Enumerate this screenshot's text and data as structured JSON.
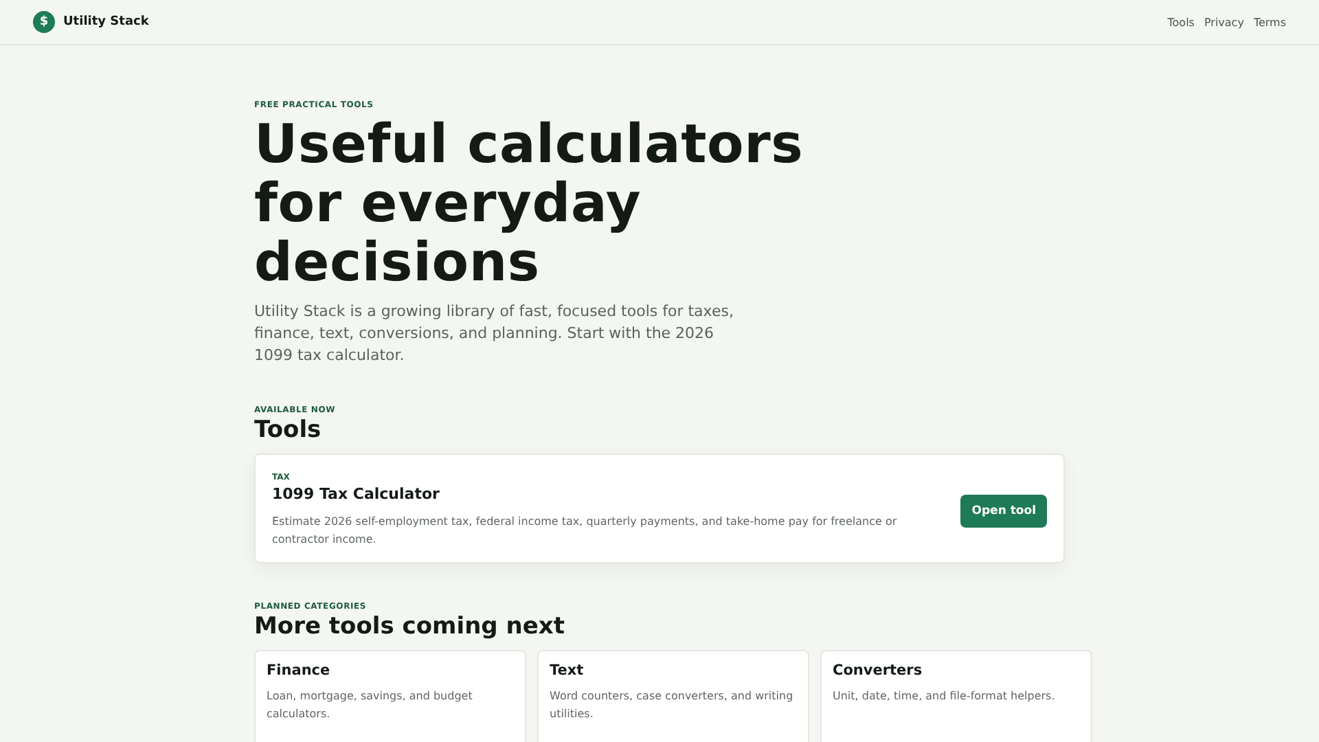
{
  "header": {
    "logo_glyph": "$",
    "brand": "Utility Stack",
    "nav": [
      "Tools",
      "Privacy",
      "Terms"
    ]
  },
  "hero": {
    "eyebrow": "FREE PRACTICAL TOOLS",
    "title": "Useful calculators for everyday decisions",
    "lead": "Utility Stack is a growing library of fast, focused tools for taxes, finance, text, conversions, and planning. Start with the 2026 1099 tax calculator."
  },
  "tools_section": {
    "eyebrow": "AVAILABLE NOW",
    "heading": "Tools",
    "tools": [
      {
        "category": "TAX",
        "name": "1099 Tax Calculator",
        "description": "Estimate 2026 self-employment tax, federal income tax, quarterly payments, and take-home pay for freelance or contractor income.",
        "button": "Open tool"
      }
    ]
  },
  "planned_section": {
    "eyebrow": "PLANNED CATEGORIES",
    "heading": "More tools coming next",
    "categories": [
      {
        "name": "Finance",
        "description": "Loan, mortgage, savings, and budget calculators."
      },
      {
        "name": "Text",
        "description": "Word counters, case converters, and writing utilities."
      },
      {
        "name": "Converters",
        "description": "Unit, date, time, and file-format helpers."
      }
    ]
  }
}
